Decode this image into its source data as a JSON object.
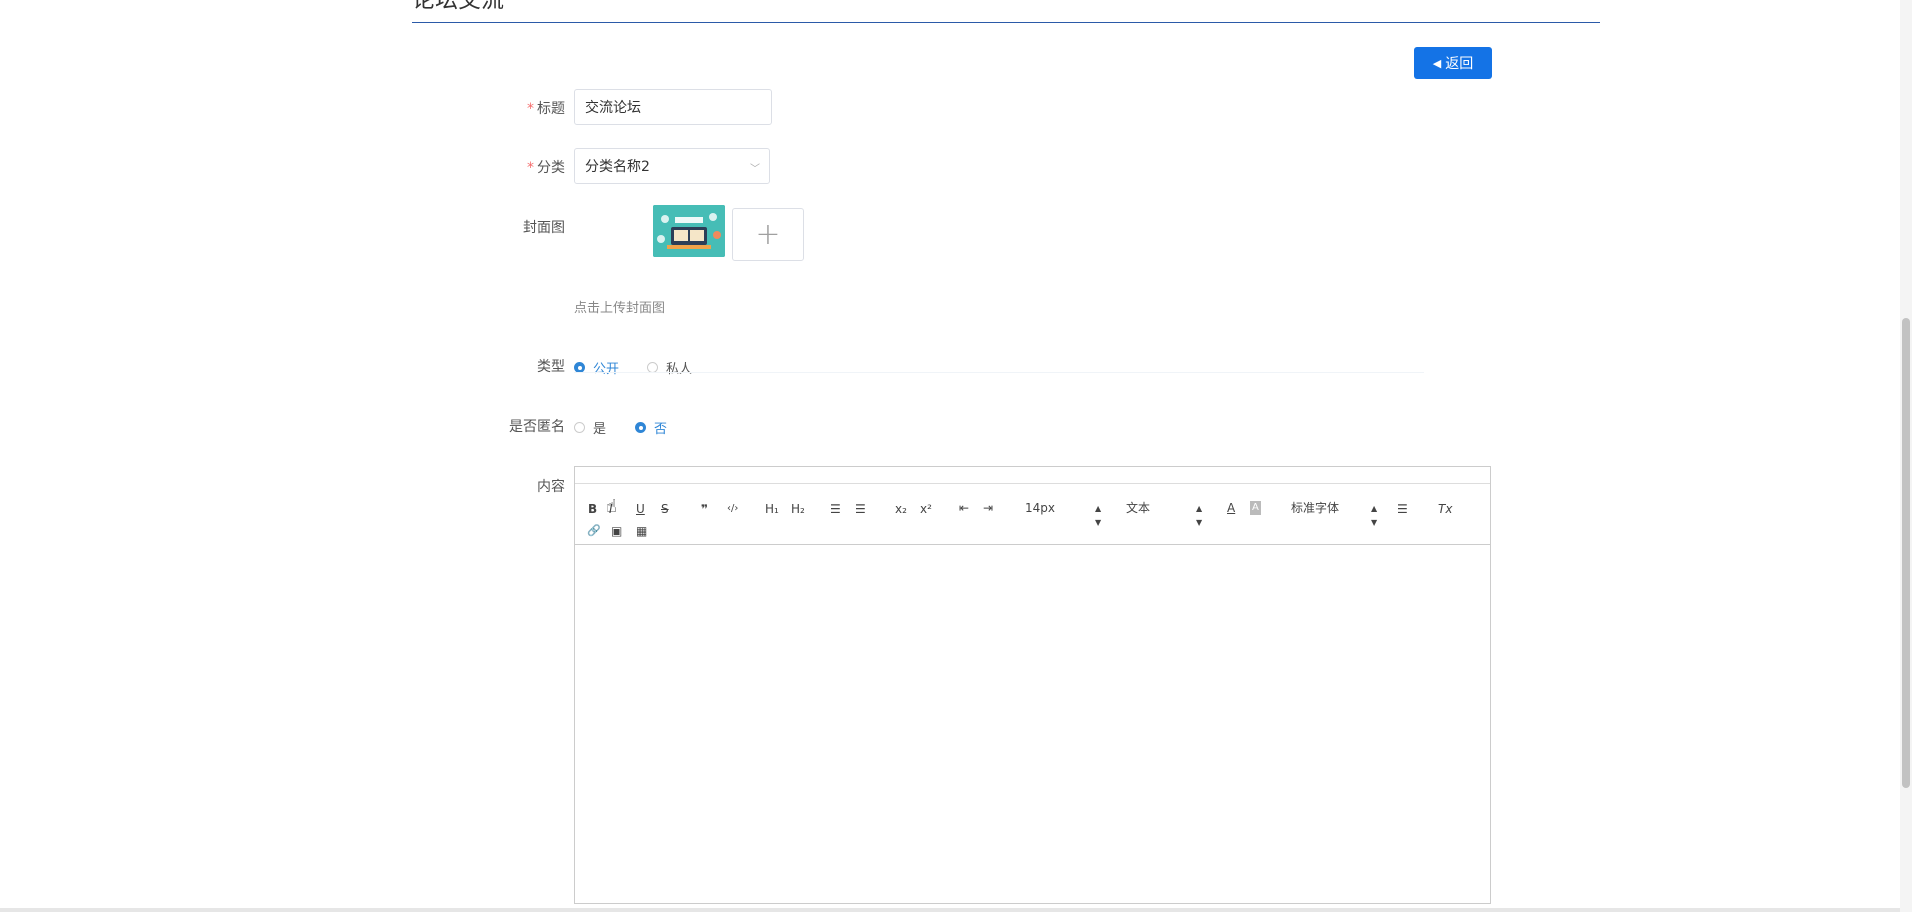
{
  "header": {
    "title": "论坛交流"
  },
  "back_button": {
    "label": "返回",
    "icon": "caret-left-icon"
  },
  "form": {
    "title": {
      "label": "标题",
      "required": "*",
      "value": "交流论坛"
    },
    "category": {
      "label": "分类",
      "required": "*",
      "value": "分类名称2"
    },
    "cover": {
      "label": "封面图",
      "upload_symbol": "+",
      "hint": "点击上传封面图"
    },
    "type": {
      "label": "类型",
      "options": [
        "公开",
        "私人"
      ],
      "selected": "公开"
    },
    "anonymous": {
      "label": "是否匿名",
      "options": [
        "是",
        "否"
      ],
      "selected": "否"
    },
    "content": {
      "label": "内容"
    }
  },
  "editor_toolbar": {
    "bold": "B",
    "italic": "I",
    "underline": "U",
    "strike": "S",
    "quote": "❞",
    "code": "‹/›",
    "h1": "H₁",
    "h2": "H₂",
    "ordered_list": "☰",
    "bullet_list": "☰",
    "subscript": "x₂",
    "superscript": "x²",
    "outdent": "⇤",
    "indent": "⇥",
    "size": "14px",
    "header": "文本",
    "color": "A",
    "background": "A",
    "font": "标准字体",
    "align": "☰",
    "clean": "Tx",
    "link": "🔗",
    "image": "▣",
    "video": "▦"
  },
  "colors": {
    "accent": "#1473e6",
    "radio": "#2f86d6",
    "required": "#f56c6c"
  }
}
